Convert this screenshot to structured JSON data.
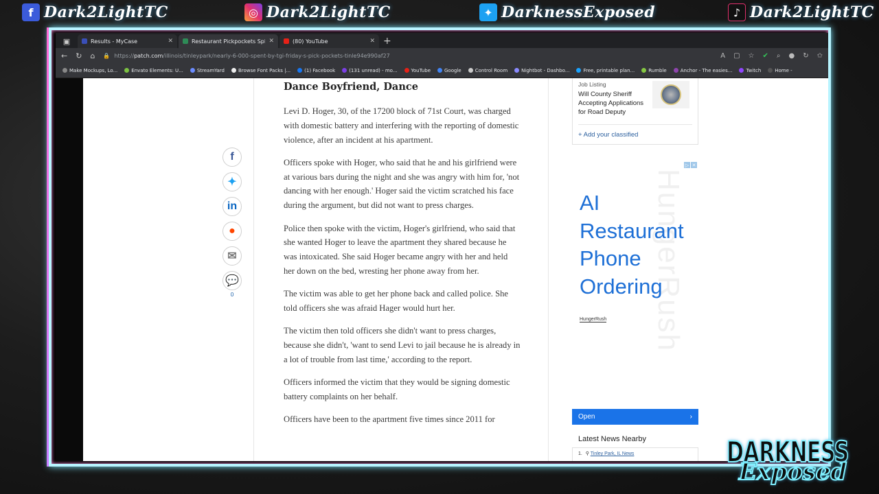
{
  "overlay": {
    "socials": [
      {
        "platform": "facebook-icon",
        "handle": "Dark2LightTC"
      },
      {
        "platform": "instagram-icon",
        "handle": "Dark2LightTC"
      },
      {
        "platform": "twitter-icon",
        "handle": "DarknessExposed"
      },
      {
        "platform": "tiktok-icon",
        "handle": "Dark2LightTC"
      }
    ],
    "logo_top": "DARKNESS",
    "logo_bottom": "Exposed"
  },
  "browser": {
    "tabs": [
      {
        "title": "Results - MyCase",
        "active": false
      },
      {
        "title": "Restaurant Pickpockets Splurge",
        "active": true
      },
      {
        "title": "(80) YouTube",
        "active": false
      }
    ],
    "url_prefix": "https://",
    "url_host": "patch.com",
    "url_path": "/illinois/tinleypark/nearly-6-000-spent-by-tgi-friday-s-pick-pockets-tinle94e990af27",
    "bookmarks": [
      "Make Mockups, Lo...",
      "Envato Elements: U...",
      "StreamYard",
      "Browse Font Packs |...",
      "(1) Facebook",
      "(131 unread) - mo...",
      "YouTube",
      "Google",
      "Control Room",
      "Nightbot - Dashbo...",
      "Free, printable plan...",
      "Rumble",
      "Anchor - The easies...",
      "Twitch",
      "Home -"
    ]
  },
  "article": {
    "heading": "Dance Boyfriend, Dance",
    "paragraphs": [
      "Levi D. Hoger, 30, of the 17200 block of 71st Court, was charged with domestic battery and interfering with the reporting of domestic violence, after an incident at his apartment.",
      "Officers spoke with Hoger, who said that he and his girlfriend were at various bars during the night and she was angry with him for, 'not dancing with her enough.' Hoger said the victim scratched his face during the argument, but did not want to press charges.",
      "Police then spoke with the victim, Hoger's girlfriend, who said that she wanted Hoger to leave the apartment they shared because he was intoxicated. She said Hoger became angry with her and held her down on the bed, wresting her phone away from her.",
      "The victim was able to get her phone back and called police. She told officers she was afraid Hager would hurt her.",
      "The victim then told officers she didn't want to press charges, because she didn't, 'want to send Levi to jail because he is already in a lot of trouble from last time,' according to the report.",
      "Officers informed the victim that they would be signing domestic battery complaints on her behalf.",
      "Officers have been to the apartment five times since 2011 for"
    ]
  },
  "share": {
    "comment_count": "0"
  },
  "sidebar": {
    "classified_label": "Job Listing",
    "classified_title": "Will County Sheriff Accepting Applications for Road Deputy",
    "add_classified": "+ Add your classified",
    "ad_headline": "AI Restaurant Phone Ordering",
    "ad_brand": "HungerRush",
    "ad_ghost": "HungerRush",
    "open_label": "Open",
    "nearby_title": "Latest News Nearby",
    "nearby_num": "1.",
    "nearby_location": "Tinley Park, IL News"
  }
}
